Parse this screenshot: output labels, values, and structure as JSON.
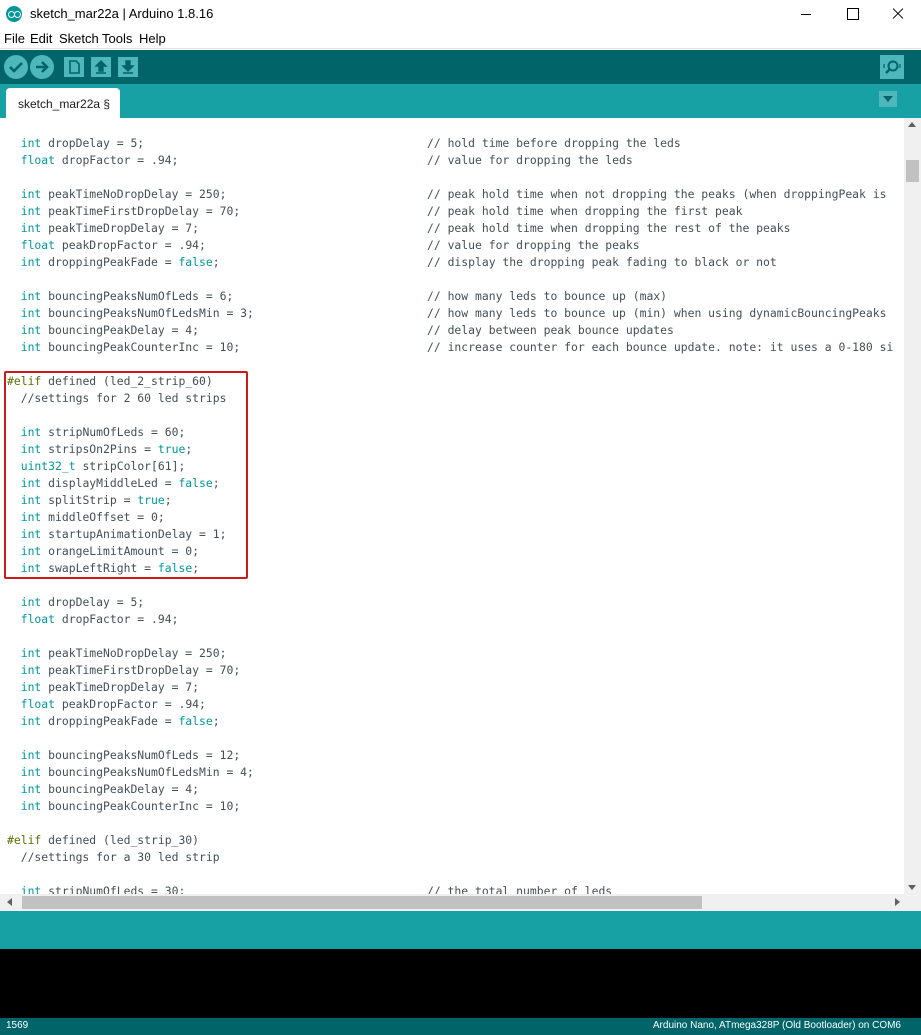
{
  "window": {
    "title": "sketch_mar22a | Arduino 1.8.16",
    "app_icon": "arduino-infinity-icon"
  },
  "menu": [
    "File",
    "Edit",
    "Sketch",
    "Tools",
    "Help"
  ],
  "toolbar": {
    "buttons": [
      "verify-icon",
      "upload-icon",
      "new-icon",
      "open-icon",
      "save-icon"
    ],
    "serial_monitor": "serial-monitor-icon"
  },
  "tabs": [
    {
      "label": "sketch_mar22a §"
    }
  ],
  "editor": {
    "lines": [
      {
        "code": "  int dropDelay = 5;",
        "comment": "// hold time before dropping the leds"
      },
      {
        "code": "  float dropFactor = .94;",
        "comment": "// value for dropping the leds"
      },
      {
        "code": "",
        "comment": ""
      },
      {
        "code": "  int peakTimeNoDropDelay = 250;",
        "comment": "// peak hold time when not dropping the peaks (when droppingPeak is"
      },
      {
        "code": "  int peakTimeFirstDropDelay = 70;",
        "comment": "// peak hold time when dropping the first peak"
      },
      {
        "code": "  int peakTimeDropDelay = 7;",
        "comment": "// peak hold time when dropping the rest of the peaks"
      },
      {
        "code": "  float peakDropFactor = .94;",
        "comment": "// value for dropping the peaks"
      },
      {
        "code": "  int droppingPeakFade = false;",
        "comment": "// display the dropping peak fading to black or not"
      },
      {
        "code": "",
        "comment": ""
      },
      {
        "code": "  int bouncingPeaksNumOfLeds = 6;",
        "comment": "// how many leds to bounce up (max)"
      },
      {
        "code": "  int bouncingPeaksNumOfLedsMin = 3;",
        "comment": "// how many leds to bounce up (min) when using dynamicBouncingPeaks"
      },
      {
        "code": "  int bouncingPeakDelay = 4;",
        "comment": "// delay between peak bounce updates"
      },
      {
        "code": "  int bouncingPeakCounterInc = 10;",
        "comment": "// increase counter for each bounce update. note: it uses a 0-180 si"
      },
      {
        "code": "",
        "comment": ""
      },
      {
        "code": "#elif defined (led_2_strip_60)",
        "comment": ""
      },
      {
        "code": "  //settings for 2 60 led strips",
        "comment": ""
      },
      {
        "code": "",
        "comment": ""
      },
      {
        "code": "  int stripNumOfLeds = 60;",
        "comment": ""
      },
      {
        "code": "  int stripsOn2Pins = true;",
        "comment": ""
      },
      {
        "code": "  uint32_t stripColor[61];",
        "comment": ""
      },
      {
        "code": "  int displayMiddleLed = false;",
        "comment": ""
      },
      {
        "code": "  int splitStrip = true;",
        "comment": ""
      },
      {
        "code": "  int middleOffset = 0;",
        "comment": ""
      },
      {
        "code": "  int startupAnimationDelay = 1;",
        "comment": ""
      },
      {
        "code": "  int orangeLimitAmount = 0;",
        "comment": ""
      },
      {
        "code": "  int swapLeftRight = false;",
        "comment": ""
      },
      {
        "code": "",
        "comment": ""
      },
      {
        "code": "  int dropDelay = 5;",
        "comment": ""
      },
      {
        "code": "  float dropFactor = .94;",
        "comment": ""
      },
      {
        "code": "",
        "comment": ""
      },
      {
        "code": "  int peakTimeNoDropDelay = 250;",
        "comment": ""
      },
      {
        "code": "  int peakTimeFirstDropDelay = 70;",
        "comment": ""
      },
      {
        "code": "  int peakTimeDropDelay = 7;",
        "comment": ""
      },
      {
        "code": "  float peakDropFactor = .94;",
        "comment": ""
      },
      {
        "code": "  int droppingPeakFade = false;",
        "comment": ""
      },
      {
        "code": "",
        "comment": ""
      },
      {
        "code": "  int bouncingPeaksNumOfLeds = 12;",
        "comment": ""
      },
      {
        "code": "  int bouncingPeaksNumOfLedsMin = 4;",
        "comment": ""
      },
      {
        "code": "  int bouncingPeakDelay = 4;",
        "comment": ""
      },
      {
        "code": "  int bouncingPeakCounterInc = 10;",
        "comment": ""
      },
      {
        "code": "",
        "comment": ""
      },
      {
        "code": "#elif defined (led_strip_30)",
        "comment": ""
      },
      {
        "code": "  //settings for a 30 led strip",
        "comment": ""
      },
      {
        "code": "",
        "comment": ""
      },
      {
        "code": "  int stripNumOfLeds = 30;",
        "comment": "// the total number of leds"
      }
    ]
  },
  "status": {
    "line_number": "1569",
    "board": "Arduino Nano, ATmega328P (Old Bootloader) on COM6"
  },
  "colors": {
    "toolbar": "#006468",
    "tabbar": "#17a1a5",
    "button": "#4db7bb",
    "keyword": "#00979c",
    "preprocessor": "#5e6d03",
    "highlight": "#cc1a1a"
  }
}
